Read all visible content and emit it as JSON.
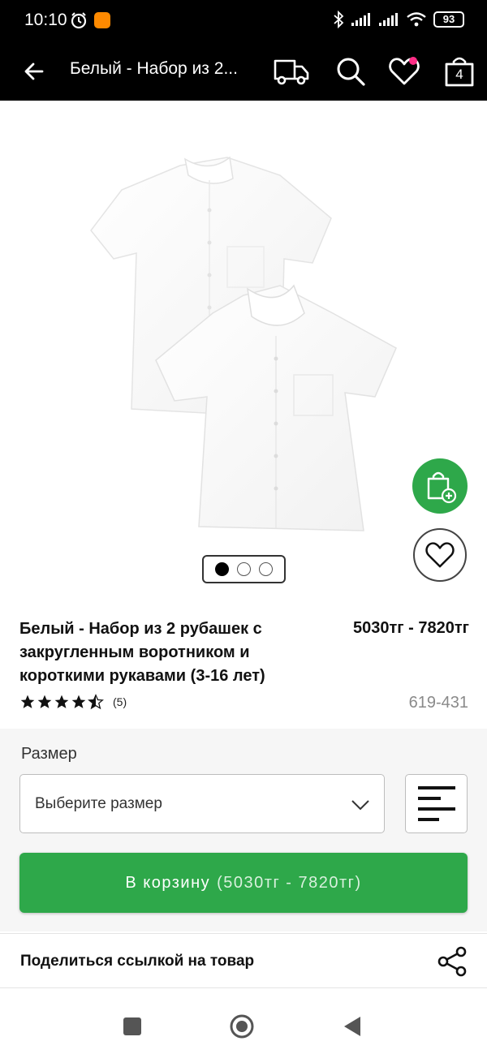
{
  "status_bar": {
    "time": "10:10",
    "battery": "93"
  },
  "app_bar": {
    "title": "Белый - Набор из 2...",
    "cart_count": "4"
  },
  "carousel": {
    "total": 3,
    "active_index": 0
  },
  "product": {
    "title": "Белый - Набор из 2 рубашек с закругленным воротником и короткими рукавами (3-16 лет)",
    "price": "5030тг - 7820тг",
    "rating": 4.5,
    "reviews": "(5)",
    "sku": "619-431"
  },
  "size": {
    "label": "Размер",
    "placeholder": "Выберите размер"
  },
  "add_to_cart": {
    "label": "В корзину",
    "price_note": "(5030тг - 7820тг)"
  },
  "share": {
    "label": "Поделиться ссылкой на товар"
  },
  "colors": {
    "accent_green": "#2ea84a",
    "wishlist_dot": "#ff2d86",
    "header_bg": "#000000"
  },
  "icons": [
    "arrow-back-icon",
    "delivery-truck-icon",
    "search-icon",
    "heart-icon",
    "shopping-bag-icon",
    "bag-add-icon",
    "chevron-down-icon",
    "size-guide-icon",
    "share-icon"
  ]
}
